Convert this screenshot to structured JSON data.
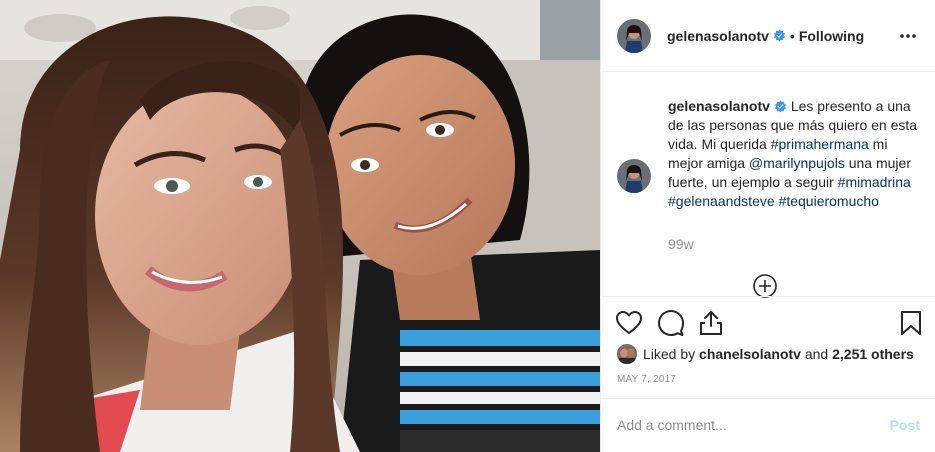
{
  "post": {
    "header": {
      "username": "gelenasolanotv",
      "separator": "•",
      "follow_status": "Following",
      "more_icon": "more-horizontal-icon"
    },
    "caption": {
      "username": "gelenasolanotv",
      "text_1": "Les presento a una de las personas que más quiero en esta vida. Mi querida ",
      "tag_1": "#primahermana",
      "text_2": " mi mejor amiga ",
      "tag_2": "@marilynpujols",
      "text_3": " una mujer fuerte, un ejemplo a seguir ",
      "tag_3": "#mimadrina",
      "tag_4": "#gelenaandsteve",
      "tag_5": "#tequieromucho",
      "time_ago": "99w"
    },
    "actions": {
      "like_icon": "heart-icon",
      "comment_icon": "comment-icon",
      "share_icon": "share-icon",
      "save_icon": "bookmark-icon",
      "load_more_icon": "plus-circle-icon"
    },
    "likes": {
      "prefix": "Liked by ",
      "liker": "chanelsolanotv",
      "middle": " and ",
      "count": "2,251 others"
    },
    "date": "MAY 7, 2017",
    "comment_box": {
      "placeholder": "Add a comment...",
      "post_label": "Post"
    },
    "colors": {
      "verified": "#3897f0",
      "link": "#00376b",
      "muted": "#8e8e8e",
      "post_disabled": "#b2dffc"
    }
  }
}
